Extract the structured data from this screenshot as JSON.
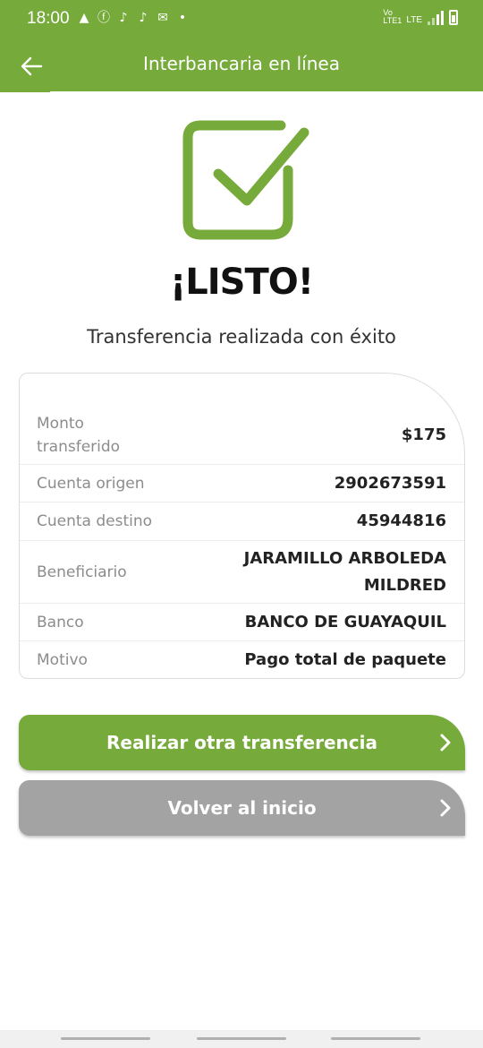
{
  "status_bar": {
    "time": "18:00",
    "network_top": "LTE",
    "network_left": "Vo LTE1",
    "icons": [
      "alert-icon",
      "facebook-icon",
      "tiktok-icon",
      "tiktok-icon",
      "message-icon",
      "dot-icon"
    ]
  },
  "header": {
    "title": "Interbancaria en línea"
  },
  "result": {
    "headline": "¡LISTO!",
    "message": "Transferencia realizada con éxito"
  },
  "details": [
    {
      "label": "Monto transferido",
      "value": "$175"
    },
    {
      "label": "Cuenta origen",
      "value": "2902673591"
    },
    {
      "label": "Cuenta destino",
      "value": "45944816"
    },
    {
      "label": "Beneficiario",
      "value": "JARAMILLO ARBOLEDA MILDRED"
    },
    {
      "label": "Banco",
      "value": "BANCO DE GUAYAQUIL"
    },
    {
      "label": "Motivo",
      "value": "Pago total de paquete"
    }
  ],
  "actions": {
    "primary_label": "Realizar otra transferencia",
    "secondary_label": "Volver al inicio"
  },
  "colors": {
    "brand_green": "#76aa3a",
    "secondary_gray": "#a3a3a3"
  }
}
